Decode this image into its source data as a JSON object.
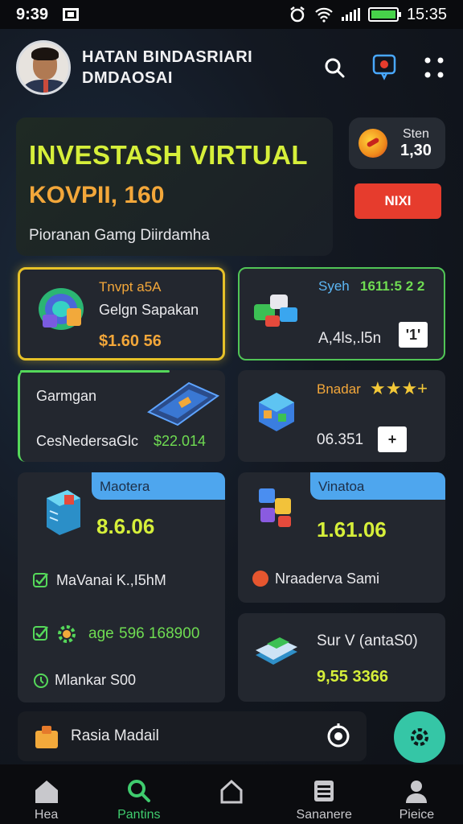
{
  "status_bar": {
    "time": "9:39",
    "battery_time": "15:35",
    "icons": [
      "sim-card-icon",
      "alarm-icon",
      "wifi-icon",
      "signal-icon",
      "battery-icon"
    ]
  },
  "header": {
    "name_line1": "HATAN BINDASRIARI",
    "name_line2": "DMDAOSAI",
    "icons": [
      "search-icon",
      "chat-icon",
      "more-icon"
    ]
  },
  "hero": {
    "title": "INVESTASH VIRTUAL",
    "amount": "KOVPII, 160",
    "subtitle": "Pioranan Gamg Diirdamha"
  },
  "stat": {
    "label": "Sten",
    "value": "1,30"
  },
  "next_button": "NIXI",
  "cards": {
    "c1": {
      "title": "Tnvpt a5A",
      "subtitle": "Gelgn Sapakan",
      "value": "$1.60 56"
    },
    "c2": {
      "label": "Syeh",
      "code": "1611:5 2 2",
      "value": "A,4ls,.l5n",
      "button": "'1'"
    },
    "c3": {
      "title": "Garmgan",
      "label": "CesNedersaGlc",
      "value": "$22.014"
    },
    "c4": {
      "label": "Bnadar",
      "stars": "★★★+",
      "value": "06.351",
      "button": "+"
    },
    "c5": {
      "tag": "Maotera",
      "value": "8.6.06",
      "row1": "MaVanai K.,I5hM",
      "row2_label": "age",
      "row2_value": "596 168900",
      "row3": "Mlankar S00"
    },
    "c6": {
      "tag": "Vinatoa",
      "value": "1.61.06",
      "row": "Nraaderva Sami"
    },
    "c7": {
      "label": "Sur V (antaS0)",
      "value": "9,55 3366"
    }
  },
  "bottom_row": {
    "label": "Rasia Madail"
  },
  "nav": [
    {
      "label": "Hea",
      "icon": "home-icon"
    },
    {
      "label": "Pantins",
      "icon": "search-icon"
    },
    {
      "label": "",
      "icon": "house-outline-icon"
    },
    {
      "label": "Sananere",
      "icon": "stack-icon"
    },
    {
      "label": "Pieice",
      "icon": "profile-icon"
    }
  ],
  "colors": {
    "accent_green": "#55d85a",
    "accent_yellow": "#d6ef3a",
    "accent_orange": "#f3a73a",
    "accent_red": "#e63c2d",
    "tag_blue": "#4ea6ee",
    "fab_teal": "#35c6a6"
  }
}
